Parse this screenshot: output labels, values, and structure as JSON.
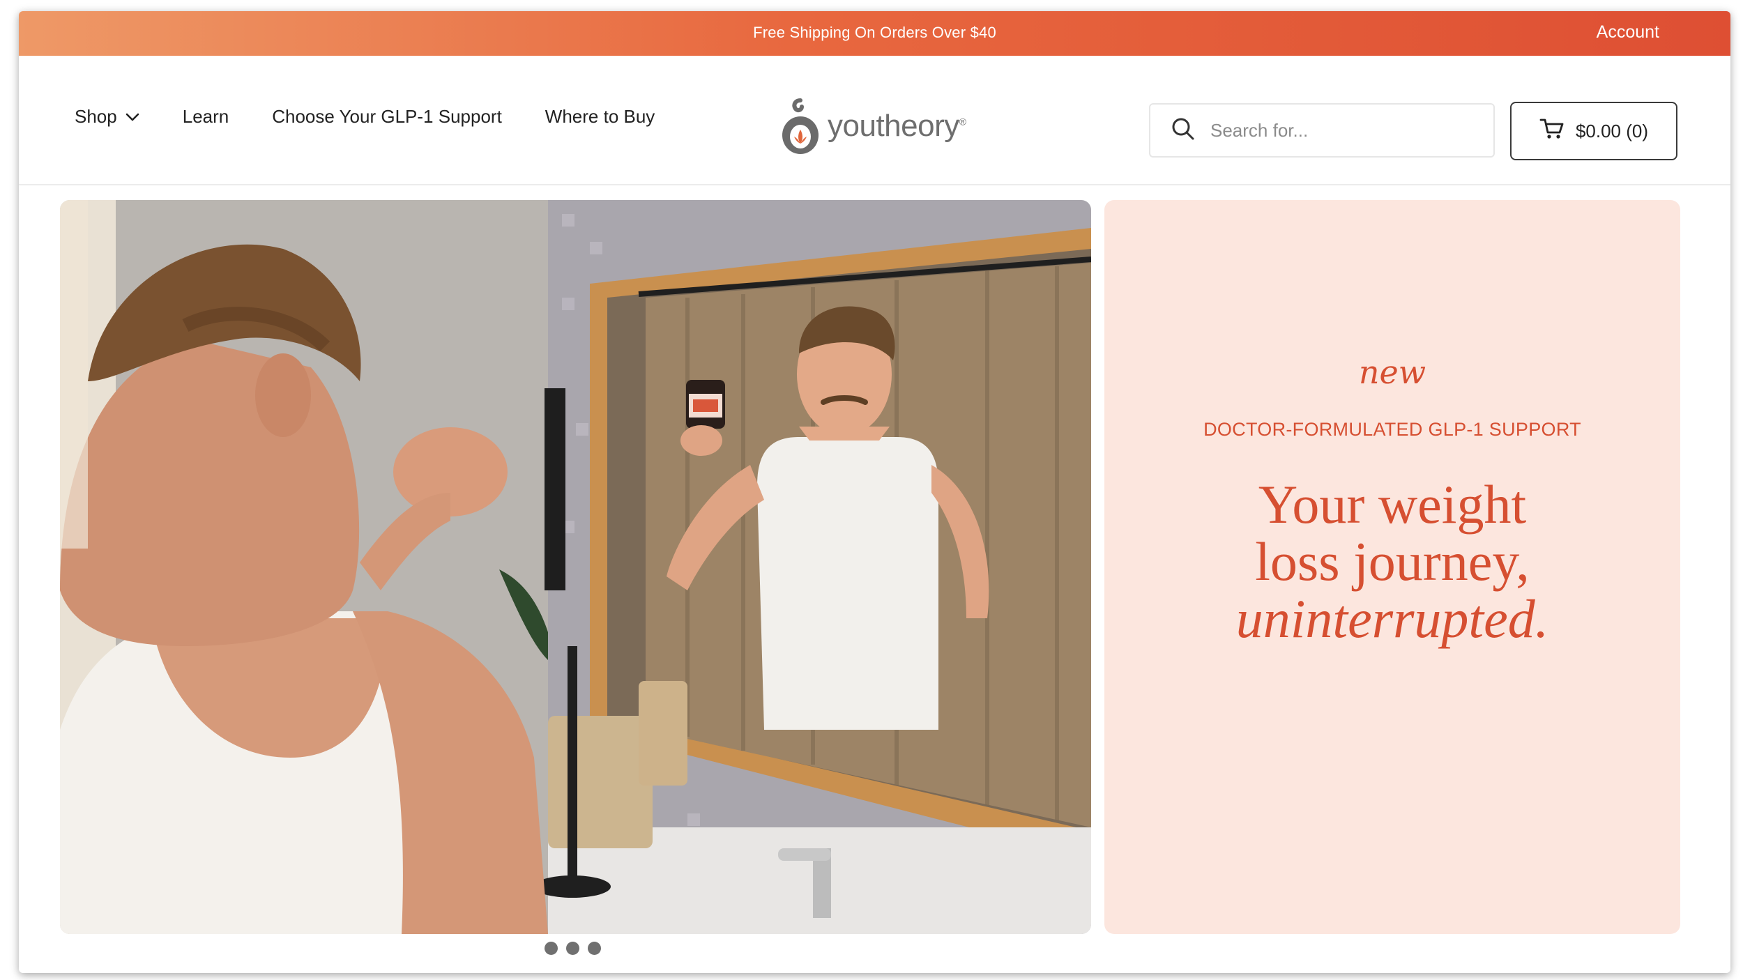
{
  "announcement": {
    "promo_text": "Free Shipping On Orders Over $40",
    "account_label": "Account"
  },
  "nav": {
    "items": [
      {
        "label": "Shop",
        "has_dropdown": true
      },
      {
        "label": "Learn"
      },
      {
        "label": "Choose Your GLP-1 Support"
      },
      {
        "label": "Where to Buy"
      }
    ]
  },
  "logo": {
    "wordmark": "youtheory",
    "mark": "®"
  },
  "search": {
    "placeholder": "Search for..."
  },
  "cart": {
    "label": "$0.00 (0)"
  },
  "hero": {
    "eyebrow": "new",
    "kicker": "DOCTOR-FORMULATED GLP-1 SUPPORT",
    "headline_line1": "Your weight",
    "headline_line2": "loss journey,",
    "headline_line3": "uninterrupted."
  },
  "carousel": {
    "slide_count": 3
  },
  "colors": {
    "accent": "#d64f31",
    "panel_bg": "#fce6de",
    "announce_start": "#ee9967",
    "announce_end": "#de4f33"
  }
}
